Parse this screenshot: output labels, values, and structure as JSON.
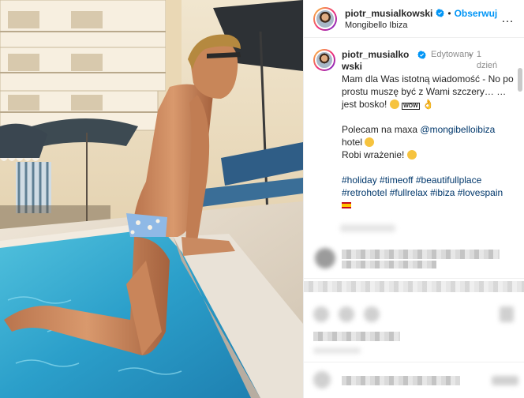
{
  "post": {
    "author": "piotr_musialkowski",
    "follow_label": "Obserwuj",
    "dot": "•",
    "location": "Mongibello Ibiza",
    "more": "…"
  },
  "caption": {
    "username": "piotr_musialkowski",
    "edited_label": "Edytowany",
    "separator": "•",
    "time": "1 dzień",
    "line1": "Mam dla Was istotną wiadomość - No po prostu muszę być z Wami szczery… …jest bosko!",
    "wow_label": "WOW",
    "line2_prefix": "Polecam na maxa",
    "line2_mention": "@mongibelloibiza",
    "line2_suffix": "hotel",
    "line3": "Robi wrażenie!",
    "hashtags": [
      "#holiday",
      "#timeoff",
      "#beautifullplace",
      "#retrohotel",
      "#fullrelax",
      "#ibiza",
      "#lovespain"
    ]
  },
  "colors": {
    "link_blue": "#0095f6",
    "hashtag": "#00376b",
    "verified": "#0095f6",
    "pool": "#2fa6c9"
  },
  "icons": [
    "verified-badge-icon",
    "more-options-icon",
    "emoji-icon",
    "spain-flag-icon"
  ]
}
